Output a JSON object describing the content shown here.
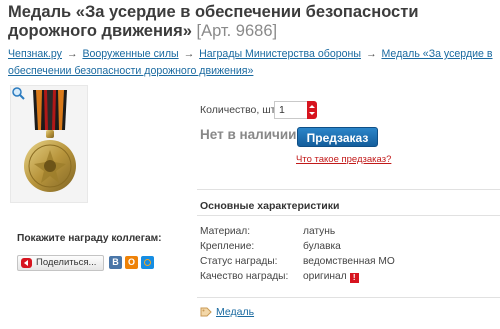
{
  "product": {
    "title": "Медаль «За усердие в обеспечении безопасности дорожного движения»",
    "article": "[Арт. 9686]"
  },
  "breadcrumb": {
    "items": [
      "Чепзнак.ру",
      "Вооруженные силы",
      "Награды Министерства обороны",
      "Медаль «За усердие в обеспечении безопасности дорожного движения»"
    ],
    "separator": "→"
  },
  "order": {
    "quantity_label": "Количество, шт:",
    "quantity_value": "1",
    "stock_status": "Нет в наличии",
    "preorder_button": "Предзаказ",
    "preorder_link": "Что такое предзаказ?"
  },
  "share": {
    "label": "Покажите награду коллегам:",
    "button": "Поделиться...",
    "networks": [
      "В",
      "О",
      "@"
    ]
  },
  "specs": {
    "title": "Основные характеристики",
    "rows": [
      {
        "key": "Материал:",
        "value": "латунь"
      },
      {
        "key": "Крепление:",
        "value": "булавка"
      },
      {
        "key": "Статус награды:",
        "value": "ведомственная МО"
      },
      {
        "key": "Качество награды:",
        "value": "оригинал",
        "badge": "!"
      }
    ]
  },
  "tags": {
    "items": [
      "Медаль"
    ]
  },
  "icons": {
    "zoom": "magnifier-zoom-icon",
    "tag": "tag-icon",
    "share": "share-icon",
    "stepper": "quantity-stepper-arrows"
  },
  "colors": {
    "link": "#1a6aa0",
    "accent_red": "#d7141f",
    "button_blue": "#145e9c"
  }
}
